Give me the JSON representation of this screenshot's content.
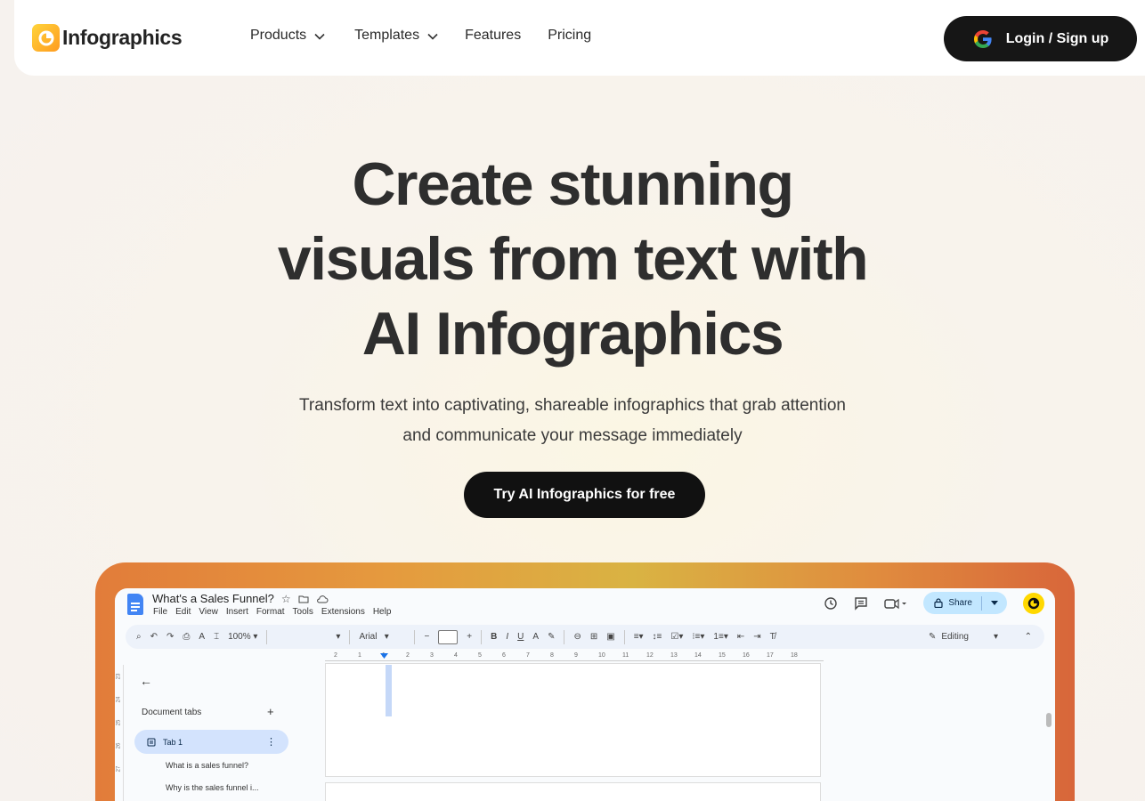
{
  "nav": {
    "logo_text": "Infographics",
    "items": [
      {
        "label": "Products",
        "has_dropdown": true
      },
      {
        "label": "Templates",
        "has_dropdown": true
      },
      {
        "label": "Features",
        "has_dropdown": false
      },
      {
        "label": "Pricing",
        "has_dropdown": false
      }
    ],
    "login_label": "Login / Sign up"
  },
  "hero": {
    "title_line1": "Create stunning",
    "title_line2": "visuals from text with",
    "title_line3": "AI Infographics",
    "subtitle_line1": "Transform text into captivating, shareable infographics that grab attention",
    "subtitle_line2": "and communicate your message immediately",
    "cta_label": "Try AI Infographics for free"
  },
  "doc_preview": {
    "title": "What's a Sales Funnel?",
    "menu": [
      "File",
      "Edit",
      "View",
      "Insert",
      "Format",
      "Tools",
      "Extensions",
      "Help"
    ],
    "share_label": "Share",
    "zoom": "100%",
    "font": "Arial",
    "mode": "Editing",
    "ruler_numbers": [
      "2",
      "1",
      "1",
      "2",
      "3",
      "4",
      "5",
      "6",
      "7",
      "8",
      "9",
      "10",
      "11",
      "12",
      "13",
      "14",
      "15",
      "16",
      "17",
      "18"
    ],
    "left_ruler_numbers": [
      "23",
      "24",
      "25",
      "26",
      "27"
    ],
    "sidebar": {
      "heading": "Document tabs",
      "tab_label": "Tab 1",
      "outline": [
        "What is a sales funnel?",
        "Why is the sales funnel i..."
      ]
    }
  },
  "colors": {
    "dark_button": "#161616",
    "share_bg": "#c2e7ff",
    "tab_active_bg": "#d3e3fd",
    "brand_yellow": "#ffd43b"
  }
}
